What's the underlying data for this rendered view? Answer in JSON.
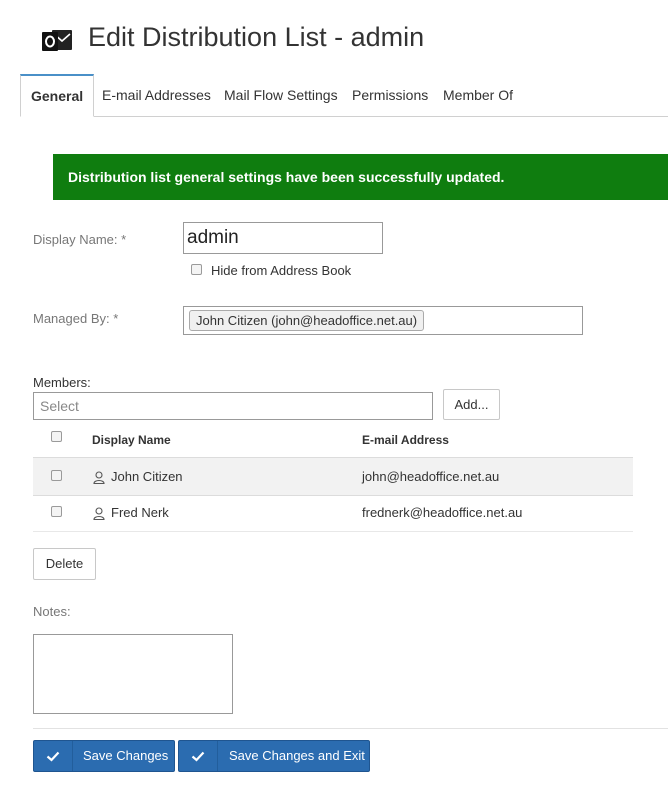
{
  "header": {
    "title": "Edit Distribution List - admin",
    "icon": "outlook-icon"
  },
  "tabs": [
    {
      "label": "General",
      "active": true
    },
    {
      "label": "E-mail Addresses",
      "active": false
    },
    {
      "label": "Mail Flow Settings",
      "active": false
    },
    {
      "label": "Permissions",
      "active": false
    },
    {
      "label": "Member Of",
      "active": false
    }
  ],
  "alert": {
    "message": "Distribution list general settings have been successfully updated.",
    "color": "#0f7d0f"
  },
  "form": {
    "display_name_label": "Display Name: *",
    "display_name_value": "admin",
    "hide_label": "Hide from Address Book",
    "hide_checked": false,
    "managed_by_label": "Managed By: *",
    "managed_by_value": "John Citizen (john@headoffice.net.au)",
    "members_label": "Members:",
    "members_placeholder": "Select",
    "add_label": "Add...",
    "notes_label": "Notes:",
    "notes_value": ""
  },
  "members_table": {
    "headers": {
      "display_name": "Display Name",
      "email": "E-mail Address"
    },
    "rows": [
      {
        "name": "John Citizen",
        "email": "john@headoffice.net.au",
        "icon": "user-icon"
      },
      {
        "name": "Fred Nerk",
        "email": "frednerk@headoffice.net.au",
        "icon": "user-icon"
      }
    ]
  },
  "buttons": {
    "delete_label": "Delete",
    "save_label": "Save Changes",
    "save_exit_label": "Save Changes and Exit"
  },
  "colors": {
    "primary": "#2b6cb0",
    "success": "#0f7d0f",
    "tab_accent": "#4a90c8"
  }
}
